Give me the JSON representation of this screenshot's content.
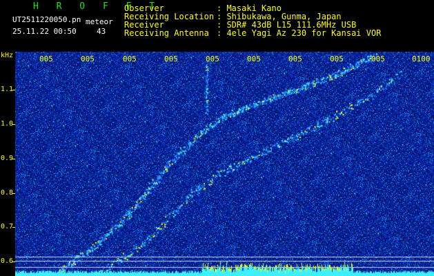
{
  "header": {
    "app_title": "H R O F F T",
    "filename": "UT2511220050.pn",
    "detection_label": "meteor",
    "date_time": "25.11.22 00:50",
    "meteor_count": "43",
    "info": [
      {
        "label": "Observer",
        "value": ": Masaki Kano"
      },
      {
        "label": "Receiving Location",
        "value": ": Shibukawa, Gunma, Japan"
      },
      {
        "label": "Receiver",
        "value": ": SDR# 43dB L15 111.6MHz USB"
      },
      {
        "label": "Receiving Antenna",
        "value": ": 4ele Yagi Az 230 for Kansai VOR"
      }
    ]
  },
  "plot": {
    "y_unit": "kHz",
    "y_ticks": [
      "1.1",
      "1.0",
      "0.9",
      "0.8",
      "0.7",
      "0.6"
    ],
    "x_ticks": [
      "005",
      "005",
      "005",
      "005",
      "005",
      "005",
      "005",
      "005",
      "005",
      "0100"
    ],
    "background_color": "#0a1a8c",
    "signal_colors": [
      "#3cf0ff",
      "#ffff00",
      "#ffffff"
    ]
  }
}
